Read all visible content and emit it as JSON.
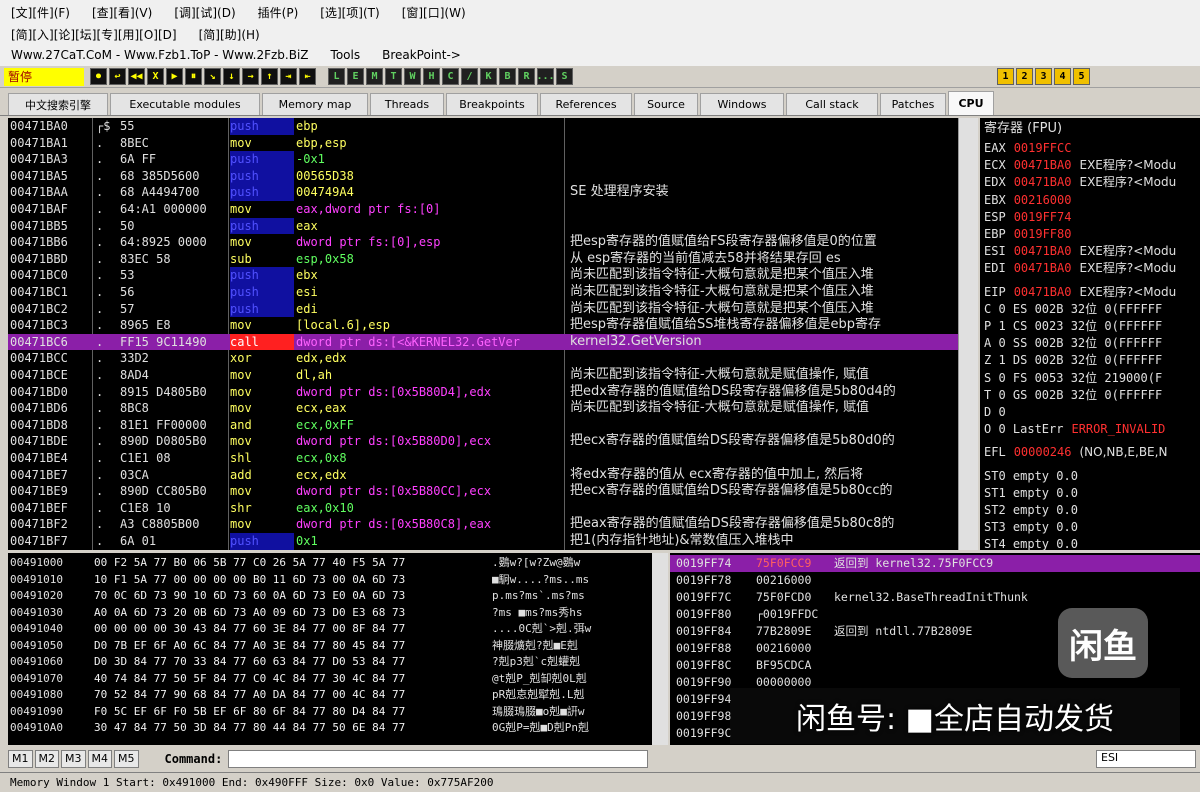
{
  "menu": {
    "row1": [
      "[文][件](F)",
      "[查][看](V)",
      "[调][试](D)",
      "插件(P)",
      "[选][项](T)",
      "[窗][口](W)"
    ],
    "row2": [
      "[简][入][论][坛][专][用][O][D]",
      "[简][助](H)"
    ],
    "row3": [
      "Www.27CaT.CoM - Www.Fzb1.ToP - Www.2Fzb.BiZ",
      "Tools",
      "BreakPoint->"
    ]
  },
  "toolbar": {
    "status": "暂停",
    "buttons": [
      "⏺",
      "↩",
      "◀◀",
      "X",
      "▶",
      "⏸",
      "↘",
      "↓",
      "→",
      "↑",
      "⇥",
      "⇤"
    ],
    "letters": [
      "L",
      "E",
      "M",
      "T",
      "W",
      "H",
      "C",
      "/",
      "K",
      "B",
      "R",
      "...",
      "S"
    ],
    "right_digits": [
      "1",
      "2",
      "3",
      "4",
      "5"
    ]
  },
  "tabs": [
    "中文搜索引擎",
    "Executable modules",
    "Memory map",
    "Threads",
    "Breakpoints",
    "References",
    "Source",
    "Windows",
    "Call stack",
    "Patches",
    "CPU"
  ],
  "colors": {
    "mnem_push": "#4040ff",
    "mnem_mov": "#ff4040",
    "mnem_call": "#ff2020",
    "op_default": "#ffff40",
    "op_mem": "#ff40ff",
    "op_imm": "#40ff40",
    "selected_row": "#8b1fa8"
  },
  "cpu_rows": [
    {
      "addr": "00471BA0",
      "mk": "┌$",
      "hex": "55",
      "mn": "push",
      "op": "ebp",
      "cm": ""
    },
    {
      "addr": "00471BA1",
      "mk": ".",
      "hex": "8BEC",
      "mn": "mov",
      "op": "ebp,esp",
      "cm": ""
    },
    {
      "addr": "00471BA3",
      "mk": ".",
      "hex": "6A FF",
      "mn": "push",
      "op": "-0x1",
      "cm": ""
    },
    {
      "addr": "00471BA5",
      "mk": ".",
      "hex": "68 385D5600",
      "mn": "push",
      "op": "00565D38",
      "cm": ""
    },
    {
      "addr": "00471BAA",
      "mk": ".",
      "hex": "68 A4494700",
      "mn": "push",
      "op": "004749A4",
      "cm": "SE 处理程序安装"
    },
    {
      "addr": "00471BAF",
      "mk": ".",
      "hex": "64:A1 000000",
      "mn": "mov",
      "op": "eax,dword ptr fs:[0]",
      "cm": ""
    },
    {
      "addr": "00471BB5",
      "mk": ".",
      "hex": "50",
      "mn": "push",
      "op": "eax",
      "cm": ""
    },
    {
      "addr": "00471BB6",
      "mk": ".",
      "hex": "64:8925 0000",
      "mn": "mov",
      "op": "dword ptr fs:[0],esp",
      "cm": "把esp寄存器的值赋值给FS段寄存器偏移值是0的位置"
    },
    {
      "addr": "00471BBD",
      "mk": ".",
      "hex": "83EC 58",
      "mn": "sub",
      "op": "esp,0x58",
      "cm": "从 esp寄存器的当前值减去58并将结果存回 es"
    },
    {
      "addr": "00471BC0",
      "mk": ".",
      "hex": "53",
      "mn": "push",
      "op": "ebx",
      "cm": "尚未匹配到该指令特征-大概句意就是把某个值压入堆"
    },
    {
      "addr": "00471BC1",
      "mk": ".",
      "hex": "56",
      "mn": "push",
      "op": "esi",
      "cm": "尚未匹配到该指令特征-大概句意就是把某个值压入堆"
    },
    {
      "addr": "00471BC2",
      "mk": ".",
      "hex": "57",
      "mn": "push",
      "op": "edi",
      "cm": "尚未匹配到该指令特征-大概句意就是把某个值压入堆"
    },
    {
      "addr": "00471BC3",
      "mk": ".",
      "hex": "8965 E8",
      "mn": "mov",
      "op": "[local.6],esp",
      "cm": "把esp寄存器值赋值给SS堆栈寄存器偏移值是ebp寄存"
    },
    {
      "addr": "00471BC6",
      "mk": ".",
      "hex": "FF15 9C11490",
      "mn": "call",
      "op": "dword ptr ds:[<&KERNEL32.GetVer",
      "cm": "kernel32.GetVersion"
    },
    {
      "addr": "00471BCC",
      "mk": ".",
      "hex": "33D2",
      "mn": "xor",
      "op": "edx,edx",
      "cm": ""
    },
    {
      "addr": "00471BCE",
      "mk": ".",
      "hex": "8AD4",
      "mn": "mov",
      "op": "dl,ah",
      "cm": "尚未匹配到该指令特征-大概句意就是赋值操作, 赋值"
    },
    {
      "addr": "00471BD0",
      "mk": ".",
      "hex": "8915 D4805B0",
      "mn": "mov",
      "op": "dword ptr ds:[0x5B80D4],edx",
      "cm": "把edx寄存器的值赋值给DS段寄存器偏移值是5b80d4的"
    },
    {
      "addr": "00471BD6",
      "mk": ".",
      "hex": "8BC8",
      "mn": "mov",
      "op": "ecx,eax",
      "cm": "尚未匹配到该指令特征-大概句意就是赋值操作, 赋值"
    },
    {
      "addr": "00471BD8",
      "mk": ".",
      "hex": "81E1 FF00000",
      "mn": "and",
      "op": "ecx,0xFF",
      "cm": ""
    },
    {
      "addr": "00471BDE",
      "mk": ".",
      "hex": "890D D0805B0",
      "mn": "mov",
      "op": "dword ptr ds:[0x5B80D0],ecx",
      "cm": "把ecx寄存器的值赋值给DS段寄存器偏移值是5b80d0的"
    },
    {
      "addr": "00471BE4",
      "mk": ".",
      "hex": "C1E1 08",
      "mn": "shl",
      "op": "ecx,0x8",
      "cm": ""
    },
    {
      "addr": "00471BE7",
      "mk": ".",
      "hex": "03CA",
      "mn": "add",
      "op": "ecx,edx",
      "cm": "将edx寄存器的值从 ecx寄存器的值中加上, 然后将"
    },
    {
      "addr": "00471BE9",
      "mk": ".",
      "hex": "890D CC805B0",
      "mn": "mov",
      "op": "dword ptr ds:[0x5B80CC],ecx",
      "cm": "把ecx寄存器的值赋值给DS段寄存器偏移值是5b80cc的"
    },
    {
      "addr": "00471BEF",
      "mk": ".",
      "hex": "C1E8 10",
      "mn": "shr",
      "op": "eax,0x10",
      "cm": ""
    },
    {
      "addr": "00471BF2",
      "mk": ".",
      "hex": "A3 C8805B00",
      "mn": "mov",
      "op": "dword ptr ds:[0x5B80C8],eax",
      "cm": "把eax寄存器的值赋值给DS段寄存器偏移值是5b80c8的"
    },
    {
      "addr": "00471BF7",
      "mk": ".",
      "hex": "6A 01",
      "mn": "push",
      "op": "0x1",
      "cm": "把1(内存指针地址)&常数值压入堆栈中"
    }
  ],
  "registers": {
    "title": "寄存器 (FPU)",
    "lines": [
      {
        "t": "EAX",
        "v": "0019FFCC",
        "c": ""
      },
      {
        "t": "ECX",
        "v": "00471BA0",
        "c": "EXE程序?<Modu"
      },
      {
        "t": "EDX",
        "v": "00471BA0",
        "c": "EXE程序?<Modu"
      },
      {
        "t": "EBX",
        "v": "00216000",
        "c": ""
      },
      {
        "t": "ESP",
        "v": "0019FF74",
        "c": ""
      },
      {
        "t": "EBP",
        "v": "0019FF80",
        "c": ""
      },
      {
        "t": "ESI",
        "v": "00471BA0",
        "c": "EXE程序?<Modu"
      },
      {
        "t": "EDI",
        "v": "00471BA0",
        "c": "EXE程序?<Modu"
      },
      {
        "t": "EIP",
        "v": "00471BA0",
        "c": "EXE程序?<Modu"
      },
      {
        "t": "C 0  ES 002B 32位 0(FFFFFF",
        "v": "",
        "c": ""
      },
      {
        "t": "P 1  CS 0023 32位 0(FFFFFF",
        "v": "",
        "c": ""
      },
      {
        "t": "A 0  SS 002B 32位 0(FFFFFF",
        "v": "",
        "c": ""
      },
      {
        "t": "Z 1  DS 002B 32位 0(FFFFFF",
        "v": "",
        "c": ""
      },
      {
        "t": "S 0  FS 0053 32位 219000(F",
        "v": "",
        "c": ""
      },
      {
        "t": "T 0  GS 002B 32位 0(FFFFFF",
        "v": "",
        "c": ""
      },
      {
        "t": "D 0",
        "v": "",
        "c": ""
      },
      {
        "t": "O 0  LastErr",
        "v": "ERROR_INVALID",
        "c": ""
      },
      {
        "t": "EFL",
        "v": "00000246",
        "c": "(NO,NB,E,BE,N"
      },
      {
        "t": "ST0 empty 0.0",
        "v": "",
        "c": ""
      },
      {
        "t": "ST1 empty 0.0",
        "v": "",
        "c": ""
      },
      {
        "t": "ST2 empty 0.0",
        "v": "",
        "c": ""
      },
      {
        "t": "ST3 empty 0.0",
        "v": "",
        "c": ""
      },
      {
        "t": "ST4 empty 0.0",
        "v": "",
        "c": ""
      }
    ]
  },
  "dump_rows": [
    {
      "a": "00491000",
      "h": "00 F2 5A 77 B0 06 5B 77 C0 26 5A 77 40 F5 5A 77",
      "s": ".鷃w?[w?Zw@鷃w"
    },
    {
      "a": "00491010",
      "h": "10 F1 5A 77 00 00 00 00 B0 11 6D 73 00 0A 6D 73",
      "s": "■駉w....?ms..ms"
    },
    {
      "a": "00491020",
      "h": "70 0C 6D 73 90 10 6D 73 60 0A 6D 73 E0 0A 6D 73",
      "s": "p.ms?ms`.ms?ms"
    },
    {
      "a": "00491030",
      "h": "A0 0A 6D 73 20 0B 6D 73 A0 09 6D 73 D0 E3 68 73",
      "s": "?ms ■ms?ms秀hs"
    },
    {
      "a": "00491040",
      "h": "00 00 00 00 30 43 84 77 60 3E 84 77 00 8F 84 77",
      "s": "....0C剋`>剋.弭w"
    },
    {
      "a": "00491050",
      "h": "D0 7B EF 6F A0 6C 84 77 A0 3E 84 77 80 45 84 77",
      "s": "神腏爌剋?剋■E剋"
    },
    {
      "a": "00491060",
      "h": "D0 3D 84 77 70 33 84 77 60 63 84 77 D0 53 84 77",
      "s": "?剋p3剋`c剋蠸剋"
    },
    {
      "a": "00491070",
      "h": "40 74 84 77 50 5F 84 77 C0 4C 84 77 30 4C 84 77",
      "s": "@t剋P_剋缷剋0L剋"
    },
    {
      "a": "00491080",
      "h": "70 52 84 77 90 68 84 77 A0 DA 84 77 00 4C 84 77",
      "s": "pR剋怘剋犚剋.L剋"
    },
    {
      "a": "00491090",
      "h": "F0 5C EF 6F F0 5B EF 6F 80 6F 84 77 80 D4 84 77",
      "s": "鳿腏鳿腏■o剋■詽w"
    },
    {
      "a": "004910A0",
      "h": "30 47 84 77 50 3D 84 77 80 44 84 77 50 6E 84 77",
      "s": "0G剋P=剋■D剋Pn剋"
    }
  ],
  "stack_rows": [
    {
      "a": "0019FF74",
      "v": "75F0FCC9",
      "c": "返回到 kernel32.75F0FCC9"
    },
    {
      "a": "0019FF78",
      "v": "00216000",
      "c": ""
    },
    {
      "a": "0019FF7C",
      "v": "75F0FCD0",
      "c": "kernel32.BaseThreadInitThunk"
    },
    {
      "a": "0019FF80",
      "v": "┌0019FFDC",
      "c": ""
    },
    {
      "a": "0019FF84",
      "v": "77B2809E",
      "c": "返回到 ntdll.77B2809E"
    },
    {
      "a": "0019FF88",
      "v": "00216000",
      "c": ""
    },
    {
      "a": "0019FF8C",
      "v": "BF95CDCA",
      "c": ""
    },
    {
      "a": "0019FF90",
      "v": "00000000",
      "c": ""
    },
    {
      "a": "0019FF94",
      "v": "",
      "c": ""
    },
    {
      "a": "0019FF98",
      "v": "",
      "c": ""
    },
    {
      "a": "0019FF9C",
      "v": "",
      "c": ""
    }
  ],
  "cmdbar": {
    "mem_buttons": [
      "M1",
      "M2",
      "M3",
      "M4",
      "M5"
    ],
    "label": "Command:",
    "right": "ESI"
  },
  "statusbar": "Memory Window 1  Start: 0x491000  End: 0x490FFF  Size: 0x0 Value: 0x775AF200",
  "watermark": {
    "text": "闲鱼号: ■全店自动发货",
    "logo": "闲鱼"
  }
}
